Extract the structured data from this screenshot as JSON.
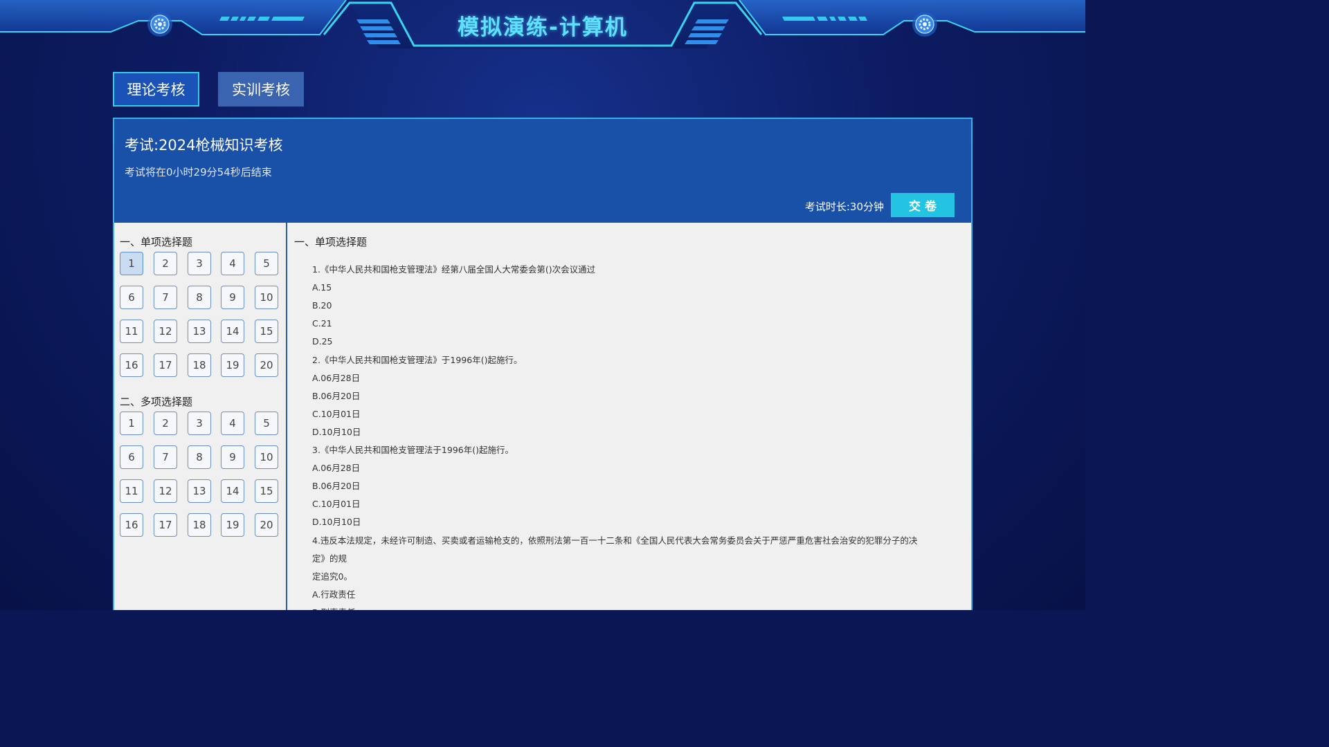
{
  "header": {
    "title": "模拟演练-计算机"
  },
  "tabs": [
    {
      "label": "理论考核",
      "active": true
    },
    {
      "label": "实训考核",
      "active": false
    }
  ],
  "exam": {
    "title": "考试:2024枪械知识考核",
    "countdown": "考试将在0小时29分54秒后结束",
    "duration": "考试时长:30分钟",
    "submit_label": "交 卷"
  },
  "nav": {
    "sections": [
      {
        "title": "一、单项选择题",
        "numbers": [
          "1",
          "2",
          "3",
          "4",
          "5",
          "6",
          "7",
          "8",
          "9",
          "10",
          "11",
          "12",
          "13",
          "14",
          "15",
          "16",
          "17",
          "18",
          "19",
          "20"
        ],
        "active_index": 0
      },
      {
        "title": "二、多项选择题",
        "numbers": [
          "1",
          "2",
          "3",
          "4",
          "5",
          "6",
          "7",
          "8",
          "9",
          "10",
          "11",
          "12",
          "13",
          "14",
          "15",
          "16",
          "17",
          "18",
          "19",
          "20"
        ],
        "active_index": -1
      }
    ]
  },
  "questions": {
    "section_title": "一、单项选择题",
    "lines": [
      "1.《中华人民共和国枪支管理法》经第八届全国人大常委会第()次会议通过",
      "A.15",
      "B.20",
      "C.21",
      "D.25",
      "2.《中华人民共和国枪支管理法》于1996年()起施行。",
      "A.06月28日",
      "B.06月20日",
      "C.10月01日",
      "D.10月10日",
      "3.《中华人民共和国枪支管理法于1996年()起施行。",
      "A.06月28日",
      "B.06月20日",
      "C.10月01日",
      "D.10月10日",
      "4.违反本法规定，未经许可制造、买卖或者运输枪支的，依照刑法第一百一十二条和《全国人民代表大会常务委员会关于严惩严重危害社会治安的犯罪分子的决",
      "定》的规",
      "定追究0。",
      "A.行政责任",
      "B.刑事责任"
    ]
  },
  "colors": {
    "background": "#0d1c63",
    "accent": "#22c4e2",
    "panel_header": "#1950a8",
    "title_glow": "#5fe0ff"
  }
}
